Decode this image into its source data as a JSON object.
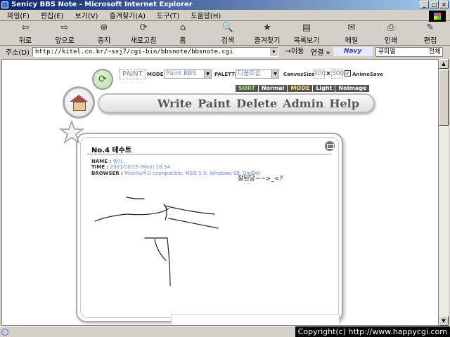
{
  "window": {
    "title": "Senicy BBS Note - Microsoft Internet Explorer",
    "buttons": [
      "_",
      "□",
      "×"
    ]
  },
  "menu": [
    "파일(F)",
    "편집(E)",
    "보기(V)",
    "즐겨찾기(A)",
    "도구(T)",
    "도움말(H)"
  ],
  "toolbar": [
    {
      "label": "뒤로",
      "icon": "back-arrow-icon",
      "glyph": "⇦"
    },
    {
      "label": "앞으로",
      "icon": "forward-arrow-icon",
      "glyph": "⇨"
    },
    {
      "label": "중지",
      "icon": "stop-icon",
      "glyph": "⊗"
    },
    {
      "label": "새로고침",
      "icon": "refresh-icon",
      "glyph": "⟳"
    },
    {
      "label": "홈",
      "icon": "home-icon",
      "glyph": "⌂"
    },
    {
      "label": "검색",
      "icon": "search-icon",
      "glyph": "🔍"
    },
    {
      "label": "즐겨찾기",
      "icon": "favorites-icon",
      "glyph": "★"
    },
    {
      "label": "목록보기",
      "icon": "history-icon",
      "glyph": "▤"
    },
    {
      "label": "메일",
      "icon": "mail-icon",
      "glyph": "✉"
    },
    {
      "label": "인쇄",
      "icon": "print-icon",
      "glyph": "⎙"
    },
    {
      "label": "편집",
      "icon": "edit-icon",
      "glyph": "✎"
    }
  ],
  "address": {
    "label": "주소(D)",
    "url": "http://kitel.co.kr/~ssj7/cgi-bin/bbsnote/bbsnote.cgi",
    "go_label": "→이동",
    "links_label": "연결 »",
    "brand": "Navy",
    "search_value": "큐피얼",
    "search_scope": "전체"
  },
  "app": {
    "paint_tag": "PAINT",
    "mode_label": "MODE",
    "mode_value": "Paint BBS",
    "palette_label": "PALETTE",
    "palette_value": "디폴트값",
    "canvas_label": "CanvasSize",
    "canvas_w": "300",
    "canvas_x": "x",
    "canvas_h": "300",
    "anime_label": "AnimeSave",
    "anime_checked": "✓",
    "view_tabs": [
      "SORT",
      "Normal",
      "MODE",
      "Light",
      "NoImage"
    ],
    "nav": [
      "Write",
      "Paint",
      "Delete",
      "Admin",
      "Help"
    ]
  },
  "post": {
    "title": "No.4 테수트",
    "name_label": "NAME :",
    "name": "헹이...",
    "time_label": "TIME :",
    "time": "2001/10/15 (Mon) 10:34",
    "browser_label": "BROWSER :",
    "browser": "Mozilla/4.0 (compatible; MSIE 5.0; Windows 98; DigExt)",
    "caption": "잘된당~~>_<?"
  },
  "status": {
    "text": "",
    "copyright": "Copyright(c) http://www.happycgi.com"
  },
  "colors": {
    "title_gradient_start": "#0a246a",
    "title_gradient_end": "#a6caf0",
    "link_blue": "#6688cc",
    "dark_tab": "#555555",
    "chrome": "#d4d0c8"
  }
}
